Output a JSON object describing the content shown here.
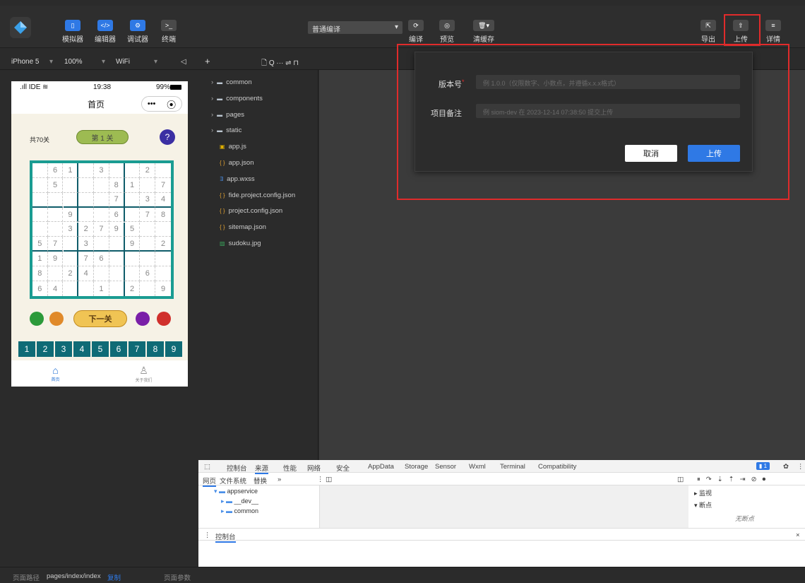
{
  "toolbar": {
    "simulator": "模拟器",
    "editor": "编辑器",
    "debugger": "调试器",
    "terminal": "终端",
    "compile_mode": "普通编译",
    "compile": "编译",
    "preview": "预览",
    "clear_cache": "清缓存",
    "export": "导出",
    "upload": "上传",
    "details": "详情"
  },
  "subbar": {
    "device": "iPhone 5",
    "zoom": "100%",
    "network": "WiFi",
    "add": "+",
    "tree_tools": "🗋 Q ··· ⇌ ⊓"
  },
  "phone": {
    "status_left": ".ıll IDE",
    "time": "19:38",
    "battery": "99%",
    "title": "首页",
    "capsule_more": "•••",
    "capsule_close": "⦿",
    "level_count": "共70关",
    "level_label": "第 1 关",
    "help": "?",
    "next_label": "下一关",
    "numbers": [
      "1",
      "2",
      "3",
      "4",
      "5",
      "6",
      "7",
      "8",
      "9"
    ],
    "tab_home": "首页",
    "tab_about": "关于我们"
  },
  "sudoku": [
    [
      "",
      "6",
      "1",
      "",
      "3",
      "",
      "",
      "2",
      ""
    ],
    [
      "",
      "5",
      "",
      "",
      "",
      "8",
      "1",
      "",
      "7"
    ],
    [
      "",
      "",
      "",
      "",
      "",
      "7",
      "",
      "3",
      "4"
    ],
    [
      "",
      "",
      "9",
      "",
      "",
      "6",
      "",
      "7",
      "8"
    ],
    [
      "",
      "",
      "3",
      "2",
      "7",
      "9",
      "5",
      "",
      ""
    ],
    [
      "5",
      "7",
      "",
      "3",
      "",
      "",
      "9",
      "",
      "2"
    ],
    [
      "1",
      "9",
      "",
      "7",
      "6",
      "",
      "",
      "",
      ""
    ],
    [
      "8",
      "",
      "2",
      "4",
      "",
      "",
      "",
      "6",
      ""
    ],
    [
      "6",
      "4",
      "",
      "",
      "1",
      "",
      "2",
      "",
      "9"
    ]
  ],
  "tree": [
    {
      "name": "common",
      "type": "folder"
    },
    {
      "name": "components",
      "type": "folder"
    },
    {
      "name": "pages",
      "type": "folder"
    },
    {
      "name": "static",
      "type": "folder"
    },
    {
      "name": "app.js",
      "type": "js"
    },
    {
      "name": "app.json",
      "type": "json"
    },
    {
      "name": "app.wxss",
      "type": "wxss"
    },
    {
      "name": "fide.project.config.json",
      "type": "json"
    },
    {
      "name": "project.config.json",
      "type": "json"
    },
    {
      "name": "sitemap.json",
      "type": "json"
    },
    {
      "name": "sudoku.jpg",
      "type": "img"
    }
  ],
  "dialog": {
    "version_label": "版本号",
    "version_placeholder": "例 1.0.0（仅限数字、小数点，并遵循x.x.x格式）",
    "remark_label": "项目备注",
    "remark_placeholder": "例 siom-dev 在 2023-12-14 07:38:50 提交上传",
    "cancel": "取消",
    "upload": "上传"
  },
  "devtools": {
    "tabs": [
      "控制台",
      "来源",
      "性能",
      "网络",
      "安全",
      "AppData",
      "Storage",
      "Sensor",
      "Wxml",
      "Terminal",
      "Compatibility"
    ],
    "badge": "1",
    "subtabs": [
      "网页",
      "文件系统",
      "替换",
      "»"
    ],
    "src_tree": [
      "appservice",
      "__dev__",
      "common"
    ],
    "watch": "监视",
    "breakpoints": "断点",
    "no_breakpoints": "无断点",
    "console_tab": "控制台"
  },
  "statusbar": {
    "path_label": "页面路径",
    "path": "pages/index/index",
    "copy": "复制",
    "params": "页面参数"
  },
  "colors": {
    "accent": "#2f79e5",
    "highlight": "#e02b2b",
    "grid": "#1a9c92",
    "numkey": "#0f6b76"
  }
}
